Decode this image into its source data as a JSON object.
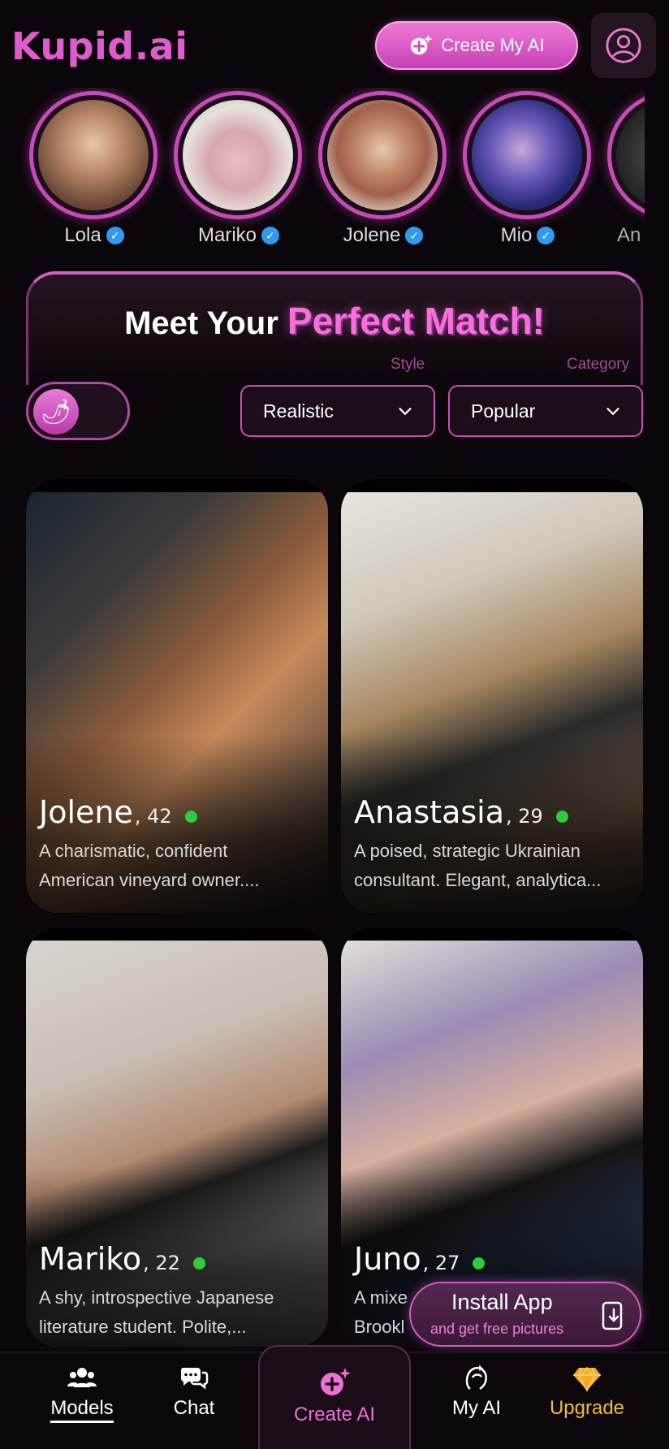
{
  "header": {
    "logo": "Kupid.ai",
    "create_label": "Create My AI",
    "icons": [
      "sparkle-plus-icon",
      "user-circle-icon"
    ]
  },
  "stories": [
    {
      "name": "Lola",
      "verified": true
    },
    {
      "name": "Mariko",
      "verified": true
    },
    {
      "name": "Jolene",
      "verified": true
    },
    {
      "name": "Mio",
      "verified": true
    },
    {
      "name": "An",
      "verified": false
    }
  ],
  "hero": {
    "title_a": "Meet Your",
    "title_b": "Perfect Match!"
  },
  "filters": {
    "style_label": "Style",
    "category_label": "Category",
    "style_value": "Realistic",
    "category_value": "Popular",
    "spicy_icon": "chili-pepper-icon"
  },
  "cards": [
    {
      "name": "Jolene",
      "age": ", 42",
      "online": true,
      "desc1": "A charismatic, confident",
      "desc2": "American vineyard owner...."
    },
    {
      "name": "Anastasia",
      "age": ", 29",
      "online": true,
      "desc1": "A poised, strategic Ukrainian",
      "desc2": "consultant. Elegant, analytica..."
    },
    {
      "name": "Mariko",
      "age": ", 22",
      "online": true,
      "desc1": "A shy, introspective Japanese",
      "desc2": "literature student. Polite,..."
    },
    {
      "name": "Juno",
      "age": ", 27",
      "online": true,
      "desc1": "A mixe",
      "desc2": "Brookl"
    }
  ],
  "install": {
    "title": "Install App",
    "subtitle": "and get free pictures"
  },
  "nav": {
    "models": "Models",
    "chat": "Chat",
    "create": "Create AI",
    "myai": "My AI",
    "upgrade": "Upgrade"
  },
  "colors": {
    "accent": "#e05bd0",
    "online": "#2ecc40",
    "verified": "#2f9af0",
    "upgrade": "#f3bd35"
  }
}
